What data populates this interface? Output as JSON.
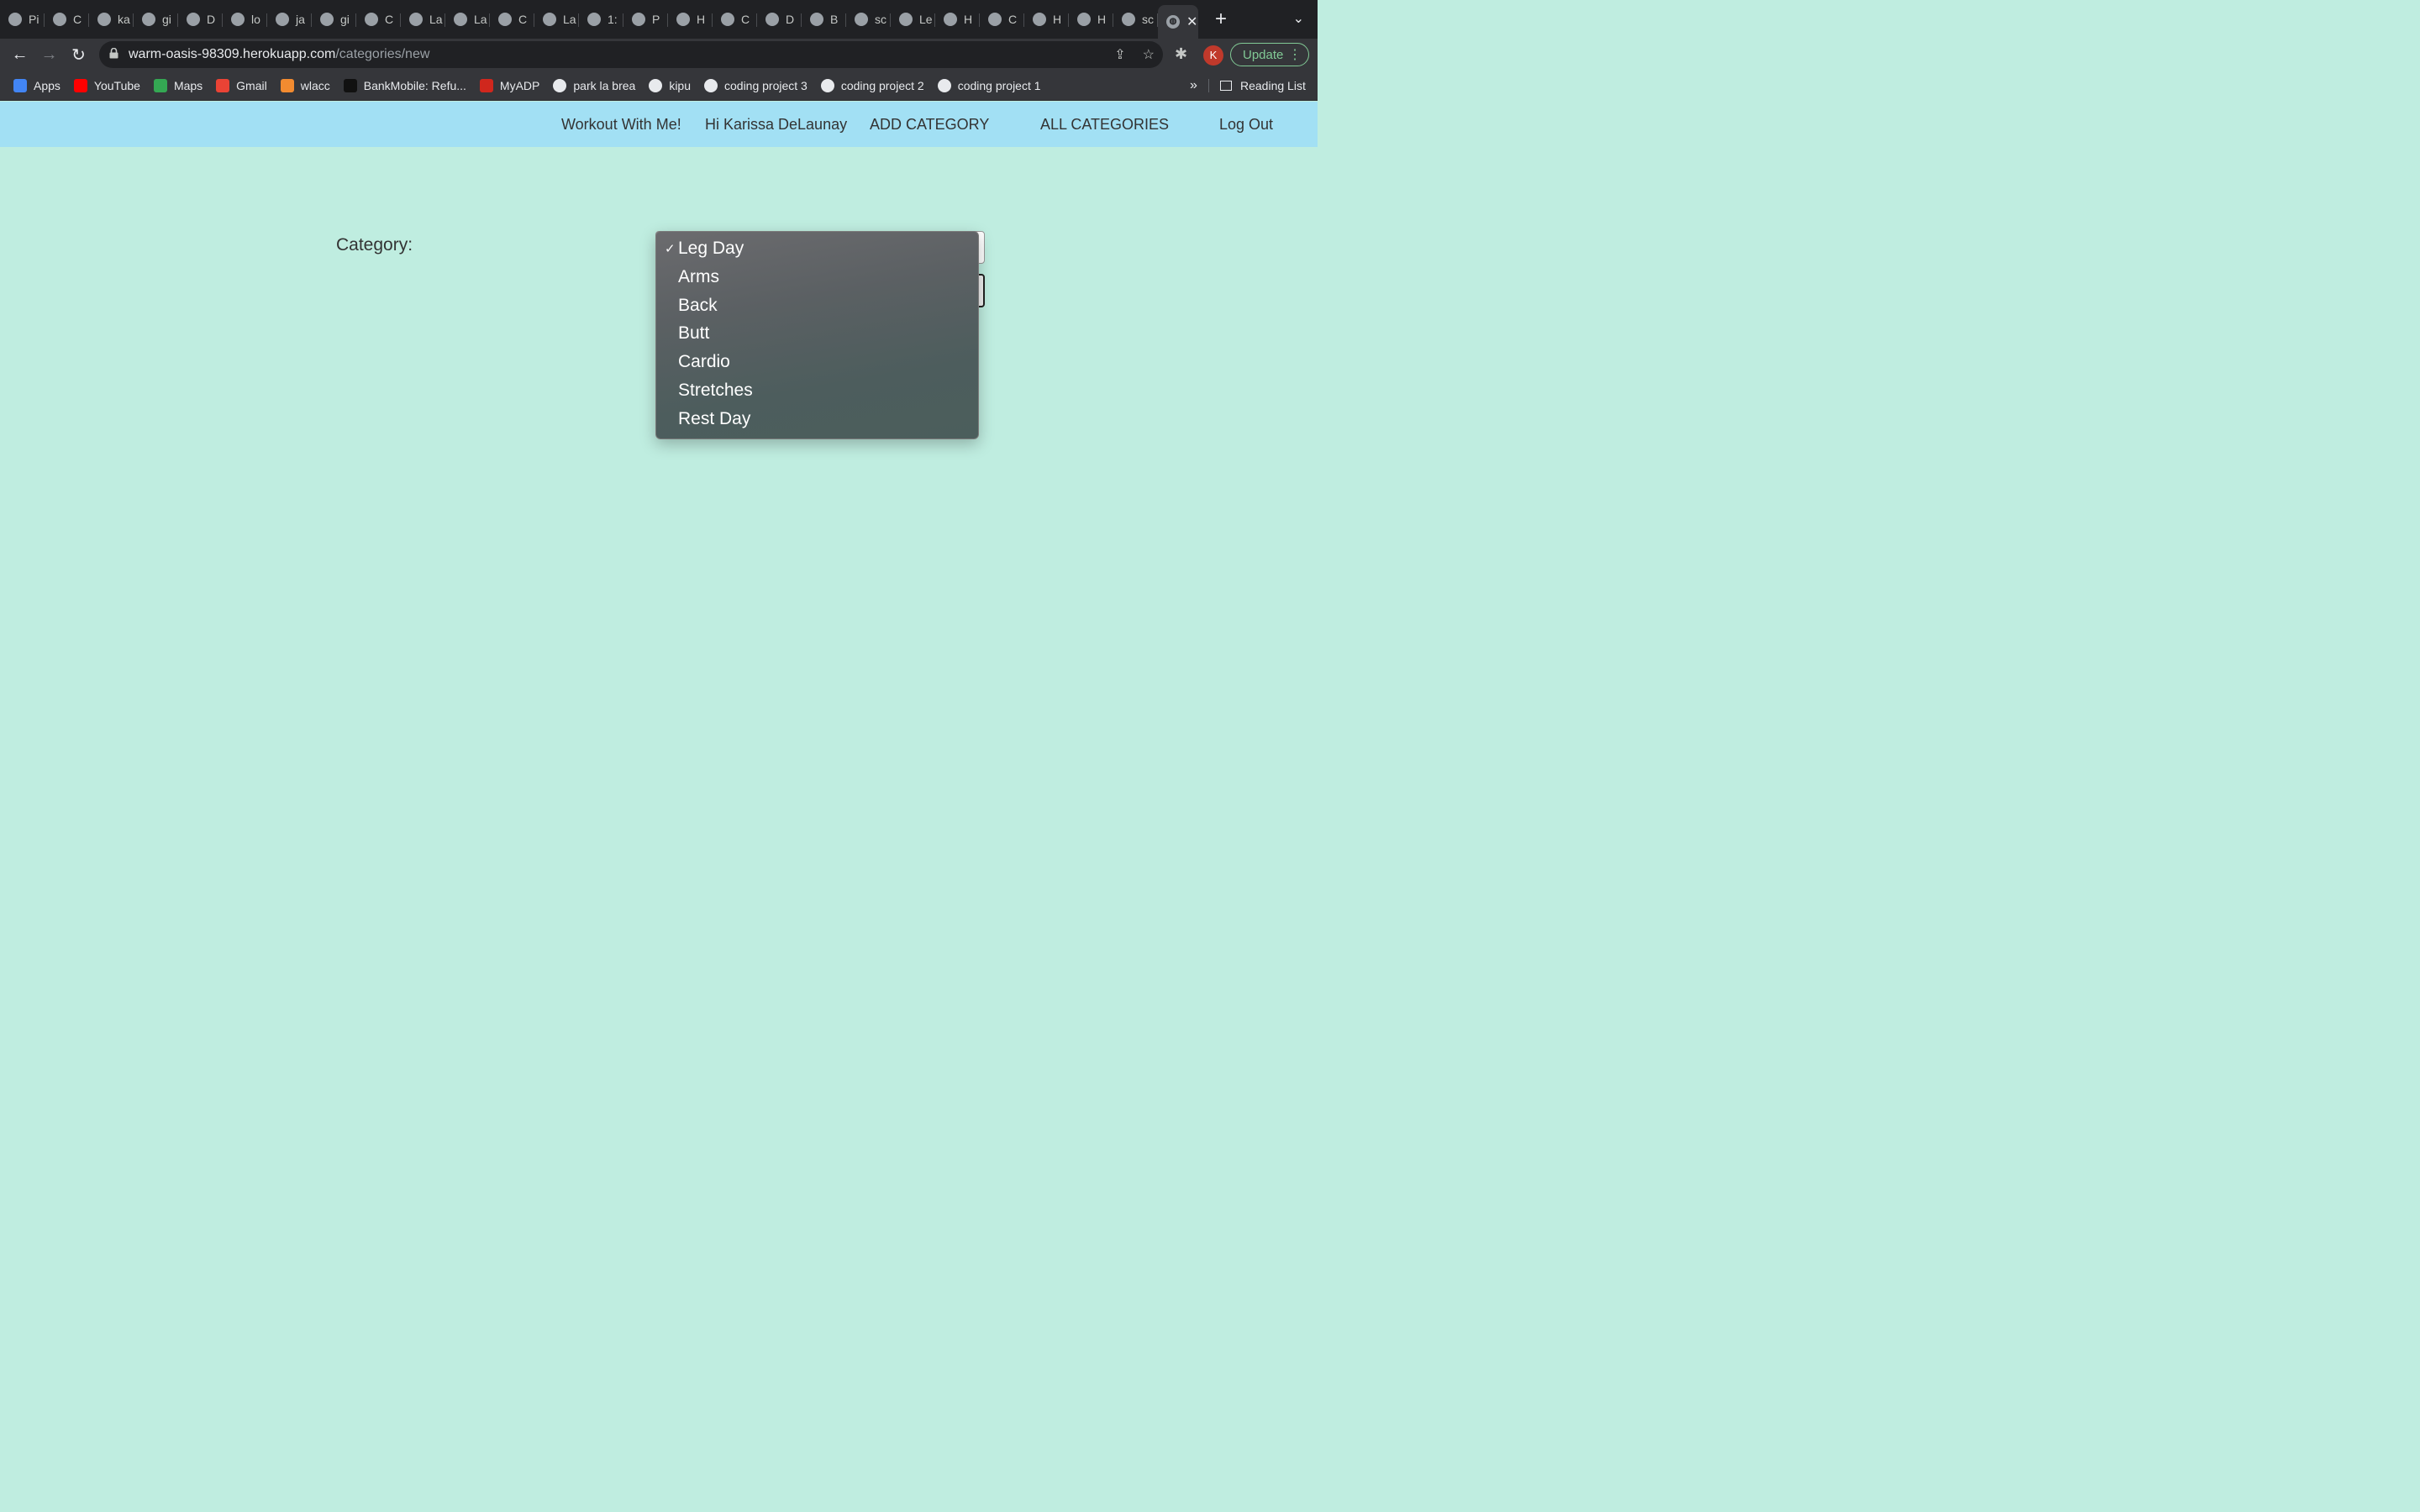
{
  "browser": {
    "tabs": [
      {
        "label": "Pi",
        "icon": "trello-icon"
      },
      {
        "label": "C",
        "icon": "api-icon"
      },
      {
        "label": "ka",
        "icon": "github-icon"
      },
      {
        "label": "gi",
        "icon": "github-icon"
      },
      {
        "label": "D",
        "icon": "leaf-icon"
      },
      {
        "label": "lo",
        "icon": "globe-icon"
      },
      {
        "label": "ja",
        "icon": "stackoverflow-icon"
      },
      {
        "label": "gi",
        "icon": "github-icon"
      },
      {
        "label": "C",
        "icon": "plus-square-icon"
      },
      {
        "label": "La",
        "icon": "globe-icon"
      },
      {
        "label": "La",
        "icon": "globe-icon"
      },
      {
        "label": "C",
        "icon": "stackoverflow-icon"
      },
      {
        "label": "La",
        "icon": "globe-icon"
      },
      {
        "label": "1:",
        "icon": "app-icon"
      },
      {
        "label": "P",
        "icon": "zoom-icon"
      },
      {
        "label": "H",
        "icon": "blank-icon"
      },
      {
        "label": "C",
        "icon": "stackoverflow-icon"
      },
      {
        "label": "D",
        "icon": "app-icon"
      },
      {
        "label": "B",
        "icon": "hex-icon"
      },
      {
        "label": "sc",
        "icon": "github-icon"
      },
      {
        "label": "Le",
        "icon": "globe-icon"
      },
      {
        "label": "H",
        "icon": "heroku-icon"
      },
      {
        "label": "C",
        "icon": "gmail-icon"
      },
      {
        "label": "H",
        "icon": "heroku-icon"
      },
      {
        "label": "H",
        "icon": "heroku-icon"
      },
      {
        "label": "sc",
        "icon": "github-icon"
      }
    ],
    "active_tab_close": "✕",
    "new_tab": "+",
    "tab_menu": "⌄",
    "back": "←",
    "forward": "→",
    "reload": "↻",
    "url_host": "warm-oasis-98309.herokuapp.com",
    "url_path": "/categories/new",
    "share": "⇪",
    "star": "☆",
    "extensions": "✱",
    "avatar_initial": "K",
    "update_label": "Update",
    "update_menu": "⋮",
    "bookmarks": [
      {
        "label": "Apps",
        "color": "#4285f4"
      },
      {
        "label": "YouTube",
        "color": "#ff0000"
      },
      {
        "label": "Maps",
        "color": "#34a853"
      },
      {
        "label": "Gmail",
        "color": "#ea4335"
      },
      {
        "label": "wlacc",
        "color": "#f28b30"
      },
      {
        "label": "BankMobile: Refu...",
        "color": "#111111"
      },
      {
        "label": "MyADP",
        "color": "#d0271d"
      },
      {
        "label": "park la brea",
        "color": "#e8eaed"
      },
      {
        "label": "kipu",
        "color": "#e8eaed"
      },
      {
        "label": "coding project 3",
        "color": "#e8eaed"
      },
      {
        "label": "coding project 2",
        "color": "#e8eaed"
      },
      {
        "label": "coding project 1",
        "color": "#e8eaed"
      }
    ],
    "bookmarks_more": "»",
    "reading_list": "Reading List"
  },
  "nav": {
    "brand": "Workout With Me!",
    "greeting": "Hi Karissa DeLaunay",
    "add_category": "ADD CATEGORY",
    "all_categories": "ALL CATEGORIES",
    "logout": "Log Out"
  },
  "form": {
    "category_label": "Category:",
    "selected": "Leg Day",
    "checkmark": "✓",
    "options": [
      "Leg Day",
      "Arms",
      "Back",
      "Butt",
      "Cardio",
      "Stretches",
      "Rest Day"
    ]
  },
  "colors": {
    "page_bg": "#bfede0",
    "nav_bg": "#a2e0f4",
    "dropdown_bg": "#555d5e",
    "update_accent": "#81c995"
  }
}
